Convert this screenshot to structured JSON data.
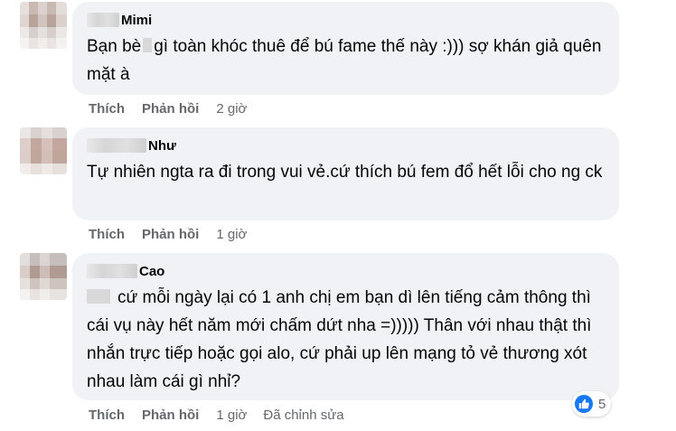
{
  "comments": [
    {
      "name": "Mimi",
      "text_before": "Bạn bè",
      "text_after": "gì toàn khóc thuê để bú fame thế này :))) sợ khán giả quên mặt à",
      "like_label": "Thích",
      "reply_label": "Phản hồi",
      "time": "2 giờ"
    },
    {
      "name": "Như",
      "text": "Tự nhiên ngta ra đi trong vui vẻ.cứ thích bú fem đổ hết lỗi cho ng ck",
      "like_label": "Thích",
      "reply_label": "Phản hồi",
      "time": "1 giờ"
    },
    {
      "name": "Cao",
      "text": "cứ mỗi ngày lại có 1 anh chị em bạn dì lên tiếng cảm thông thì cái vụ này hết năm mới chấm dứt nha =))))) Thân với nhau thật thì nhắn trực tiếp hoặc gọi alo, cứ phải up lên mạng tỏ vẻ thương xót nhau làm cái gì nhỉ?",
      "like_label": "Thích",
      "reply_label": "Phản hồi",
      "time": "1 giờ",
      "edited": "Đã chỉnh sửa",
      "reaction_count": "5",
      "reaction_icon": "like-icon"
    }
  ],
  "colors": {
    "bubble": "#f0f2f5",
    "meta": "#65676b",
    "like": "#1877f2"
  }
}
